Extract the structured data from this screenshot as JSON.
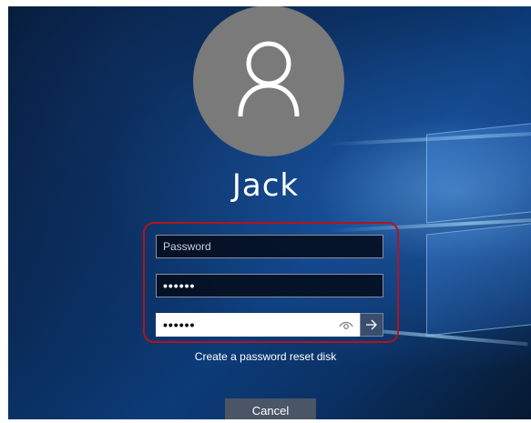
{
  "user": {
    "name": "Jack"
  },
  "fields": {
    "password_placeholder": "Password",
    "confirm_value": "••••••",
    "active_value": "••••••"
  },
  "links": {
    "reset_disk": "Create a password reset disk"
  },
  "buttons": {
    "cancel": "Cancel"
  },
  "icons": {
    "avatar": "user-icon",
    "reveal": "eye-icon",
    "submit": "arrow-right-icon"
  },
  "colors": {
    "highlight_ring": "#b2141c",
    "avatar_bg": "#7a7a7a",
    "submit_bg": "#3a4f6e"
  }
}
